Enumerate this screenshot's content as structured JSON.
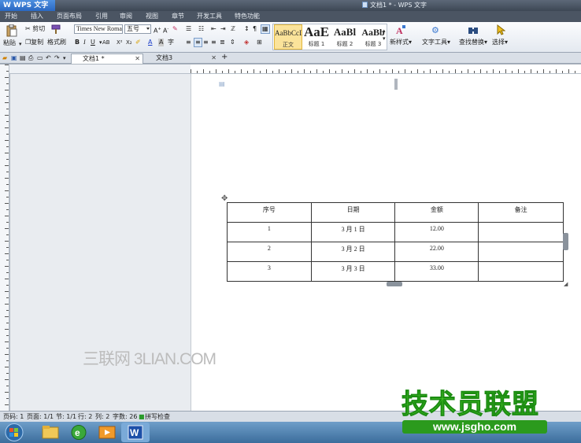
{
  "titlebar": {
    "app_name": "W WPS 文字",
    "window_title": "文档1 * - WPS 文字"
  },
  "menu": {
    "items": [
      "开始",
      "插入",
      "页面布局",
      "引用",
      "审阅",
      "视图",
      "章节",
      "开发工具",
      "特色功能"
    ]
  },
  "ribbon": {
    "paste_label": "粘贴",
    "cut_label": "剪切",
    "copy_label": "复制",
    "format_painter_label": "格式刷",
    "font_name": "Times New Roman",
    "font_size": "五号",
    "styles": [
      {
        "sample": "AaBbCcD",
        "label": "正文"
      },
      {
        "sample": "AaE",
        "label": "标题 1"
      },
      {
        "sample": "AaBl",
        "label": "标题 2"
      },
      {
        "sample": "AaBb",
        "label": "标题 3"
      }
    ],
    "new_style_label": "新样式",
    "text_tools_label": "文字工具",
    "find_replace_label": "查找替换",
    "select_label": "选择"
  },
  "doc_tabs": [
    {
      "label": "文档1 *",
      "active": true
    },
    {
      "label": "文档3",
      "active": false
    }
  ],
  "table": {
    "headers": [
      "序号",
      "日期",
      "金额",
      "备注"
    ],
    "rows": [
      [
        "1",
        "3 月 1 日",
        "12.00",
        ""
      ],
      [
        "2",
        "3 月 2 日",
        "22.00",
        ""
      ],
      [
        "3",
        "3 月 3 日",
        "33.00",
        ""
      ]
    ]
  },
  "watermark": "三联网 3LIAN.COM",
  "statusbar": {
    "page_num": "页码: 1",
    "pages": "页面: 1/1",
    "section": "节: 1/1",
    "row": "行: 2",
    "col": "列: 2",
    "words": "字数: 26",
    "spell": "拼写检查"
  },
  "brand": {
    "name": "技术员联盟",
    "url": "www.jsgho.com"
  },
  "colors": {
    "brand_green": "#4dd12a",
    "wps_blue": "#2a68c2"
  }
}
